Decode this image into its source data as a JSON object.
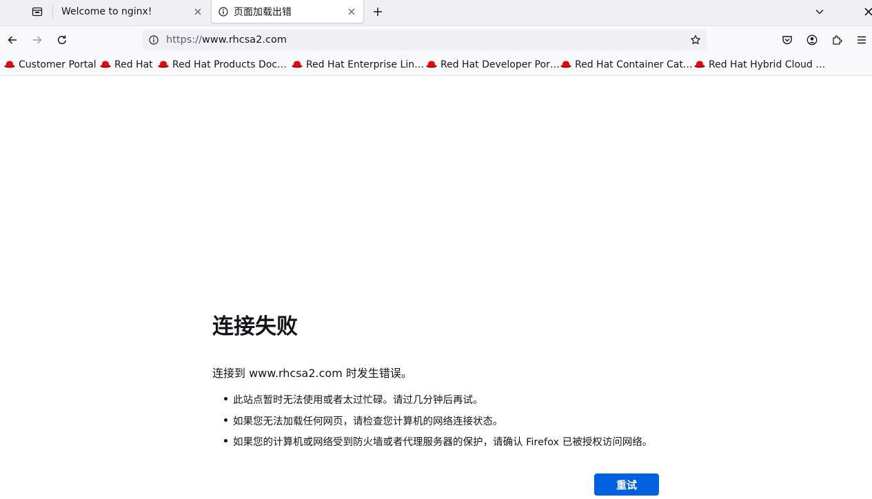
{
  "tabs": [
    {
      "title": "Welcome to nginx!",
      "active": false
    },
    {
      "title": "页面加载出错",
      "active": true
    }
  ],
  "navbar": {
    "url_prefix": "https://",
    "url_host": "www.rhcsa2.com"
  },
  "bookmarks": [
    {
      "label": "Customer Portal"
    },
    {
      "label": "Red Hat"
    },
    {
      "label": "Red Hat Products Doc…"
    },
    {
      "label": "Red Hat Enterprise Lin…"
    },
    {
      "label": "Red Hat Developer Por…"
    },
    {
      "label": "Red Hat Container Cat…"
    },
    {
      "label": "Red Hat Hybrid Cloud …"
    }
  ],
  "error": {
    "title": "连接失败",
    "description": "连接到 www.rhcsa2.com 时发生错误。",
    "items": [
      "此站点暂时无法使用或者太过忙碌。请过几分钟后再试。",
      "如果您无法加载任何网页，请检查您计算机的网络连接状态。",
      "如果您的计算机或网络受到防火墙或者代理服务器的保护，请确认 Firefox 已被授权访问网络。"
    ],
    "retry_label": "重试"
  },
  "colors": {
    "accent": "#0061e0",
    "bookmark_icon": "#ee0000"
  }
}
